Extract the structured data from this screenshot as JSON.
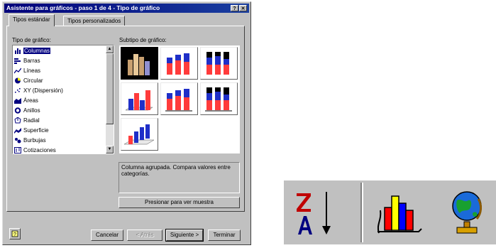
{
  "dialog": {
    "title": "Asistente para gráficos - paso 1 de 4 - Tipo de gráfico",
    "help_button": "?",
    "close_button": "✕",
    "tabs": [
      {
        "label": "Tipos estándar",
        "active": true
      },
      {
        "label": "Tipos personalizados",
        "active": false
      }
    ],
    "chart_type_label": "Tipo de gráfico:",
    "subtype_label": "Subtipo de gráfico:",
    "chart_types": [
      {
        "label": "Columnas",
        "icon": "column-chart-icon",
        "selected": true
      },
      {
        "label": "Barras",
        "icon": "bar-chart-icon"
      },
      {
        "label": "Líneas",
        "icon": "line-chart-icon"
      },
      {
        "label": "Circular",
        "icon": "pie-chart-icon"
      },
      {
        "label": "XY (Dispersión)",
        "icon": "scatter-chart-icon"
      },
      {
        "label": "Áreas",
        "icon": "area-chart-icon"
      },
      {
        "label": "Anillos",
        "icon": "doughnut-chart-icon"
      },
      {
        "label": "Radial",
        "icon": "radar-chart-icon"
      },
      {
        "label": "Superficie",
        "icon": "surface-chart-icon"
      },
      {
        "label": "Burbujas",
        "icon": "bubble-chart-icon"
      },
      {
        "label": "Cotizaciones",
        "icon": "stock-chart-icon"
      }
    ],
    "subtypes_selected_index": 0,
    "description": "Columna agrupada. Compara valores entre categorías.",
    "preview_button": "Presionar para ver muestra",
    "office_assistant_icon": "office-assistant-icon",
    "buttons": {
      "cancel": "Cancelar",
      "back": "< Atrás",
      "next": "Siguiente >",
      "finish": "Terminar"
    }
  },
  "toolbar": {
    "tools": [
      {
        "icon": "sort-descending-icon"
      },
      {
        "icon": "chart-wizard-icon"
      },
      {
        "icon": "web-globe-icon"
      }
    ]
  },
  "colors": {
    "title_bar": "#00007a",
    "face": "#c0c0c0",
    "selection": "#000080",
    "series_red": "#ff3b3b",
    "series_blue": "#1f2fc8"
  }
}
